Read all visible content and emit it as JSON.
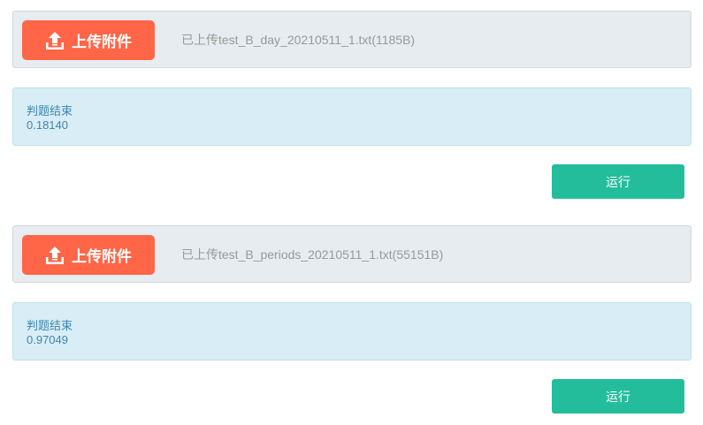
{
  "sections": [
    {
      "upload_label": "上传附件",
      "uploaded_file": "已上传test_B_day_20210511_1.txt(1185B)",
      "status": "判题结束",
      "score": "0.18140",
      "run_label": "运行"
    },
    {
      "upload_label": "上传附件",
      "uploaded_file": "已上传test_B_periods_20210511_1.txt(55151B)",
      "status": "判题结束",
      "score": "0.97049",
      "run_label": "运行"
    }
  ]
}
